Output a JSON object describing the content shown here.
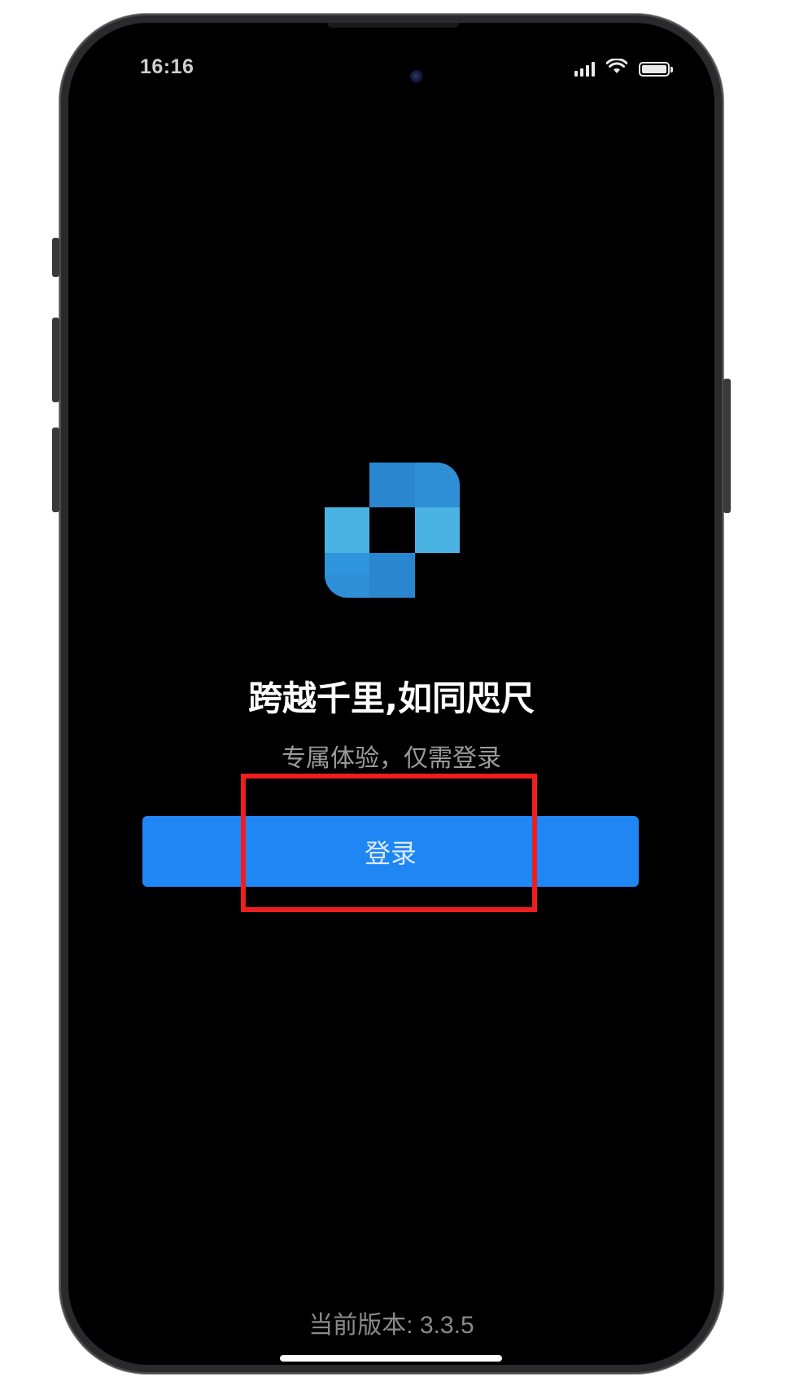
{
  "status_bar": {
    "time": "16:16",
    "icons": [
      "signal-icon",
      "wifi-icon",
      "battery-icon"
    ]
  },
  "app": {
    "logo_icon": "app-logo-icon",
    "headline": "跨越千里,如同咫尺",
    "subline": "专属体验，仅需登录",
    "login_label": "登录",
    "version_text": "当前版本: 3.3.5"
  },
  "colors": {
    "background": "#000000",
    "login_button": "#1f86f4",
    "highlight_box": "#ef1e1e",
    "logo_light": "#4ab3e3",
    "logo_dark": "#2a8ad4"
  }
}
